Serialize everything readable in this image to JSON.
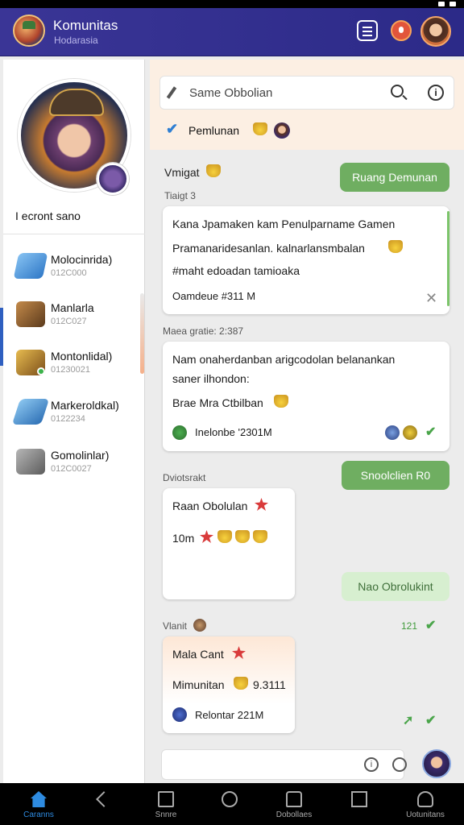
{
  "app": {
    "title": "Komunitas",
    "subtitle": "Hodarasia"
  },
  "profile": {
    "name": "I ecront sano"
  },
  "sidebar": {
    "items": [
      {
        "label": "Molocinrida)",
        "sub": "012C000",
        "icon": "blue-crystal-icon"
      },
      {
        "label": "Manlarla",
        "sub": "012C027",
        "icon": "treasure-chest-icon"
      },
      {
        "label": "Montonlidal)",
        "sub": "01230021",
        "icon": "gold-chest-icon"
      },
      {
        "label": "Markeroldkal)",
        "sub": "0122234",
        "icon": "blue-blade-icon"
      },
      {
        "label": "Gomolinlar)",
        "sub": "012C0027",
        "icon": "silver-chest-icon"
      }
    ]
  },
  "search": {
    "placeholder": "Same Obbolian"
  },
  "pinned": {
    "label": "Pemlunan"
  },
  "messages": {
    "section1_sender": "Vmigat",
    "section1_time": "Tiaigt 3",
    "pill1": "Ruang Demunan",
    "card1": {
      "line1": "Kana Jpamaken kam Penulparname Gamen",
      "line2": "Pramanaridesanlan. kalnarlansmbalan",
      "line3": "#maht edoadan tamioaka",
      "footer": "Oamdeue #311 M"
    },
    "section2_label": "Maea gratie: 2:387",
    "card2": {
      "line1": "Nam onaherdanban arigcodolan belanankan",
      "line2": "saner ilhondon:",
      "line3": "Brae Mra Ctbilban",
      "footer": "Inelonbe '2301M"
    },
    "section3_label": "Dviotsrakt",
    "pill2": "Snoolclien R0",
    "card3": {
      "title": "Raan Obolulan",
      "reactions": "10m"
    },
    "pill3": "Nao Obrolukint",
    "section4_label": "Vlanit",
    "section4_time": "121",
    "card4": {
      "title": "Mala Cant",
      "line2": "Mimunitan",
      "line2_value": "9.3111",
      "footer": "Relontar 221M"
    }
  },
  "navbar": {
    "items": [
      {
        "label": "Caranns",
        "icon": "home-icon"
      },
      {
        "label": "",
        "icon": "back-icon"
      },
      {
        "label": "Snnre",
        "icon": "share-icon"
      },
      {
        "label": "",
        "icon": "circle-icon"
      },
      {
        "label": "Dobollaes",
        "icon": "document-icon"
      },
      {
        "label": "",
        "icon": "square-icon"
      },
      {
        "label": "Uotunitans",
        "icon": "user-icon"
      }
    ]
  },
  "colors": {
    "appbar": "#3a3596",
    "accent_green": "#6fae61",
    "pinned_bg": "#fcefe3"
  }
}
